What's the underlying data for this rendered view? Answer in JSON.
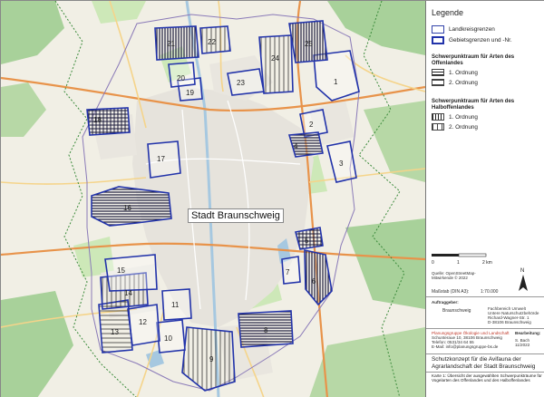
{
  "map": {
    "city_label": "Stadt Braunschweig",
    "area_numbers": [
      "1",
      "2",
      "3",
      "4",
      "5",
      "6",
      "7",
      "8",
      "9",
      "10",
      "11",
      "12",
      "13",
      "14",
      "15",
      "16",
      "17",
      "18",
      "19",
      "20",
      "21",
      "22",
      "23",
      "24",
      "25"
    ]
  },
  "legend": {
    "title": "Legende",
    "district_label": "Landkreisgrenzen",
    "area_label": "Gebietsgrenzen und -Nr.",
    "open_land_heading": "Schwerpunktraum für Arten des Offenlandes",
    "open_land_1": "1. Ordnung",
    "open_land_2": "2. Ordnung",
    "semi_open_heading": "Schwerpunktraum für Arten des Halboffenlandes",
    "semi_open_1": "1. Ordnung",
    "semi_open_2": "2. Ordnung",
    "scale_start": "0",
    "scale_mid": "1",
    "scale_end": "2 km",
    "north": "N",
    "source": "Quelle: OpenStreetMap-Mitwirkende © 2022",
    "scale_text": "Maßstab (DIN A3):",
    "scale_value": "1:70.000",
    "client_label": "Auftraggeber:",
    "client_logo": "Braunschweig",
    "client_dept": "Fachbereich Umwelt",
    "client_unit": "Untere Naturschutzbehörde",
    "client_addr1": "Richard-Wagner-Str. 1",
    "client_addr2": "D-38106 Braunschweig",
    "contractor_name": "Planungsgruppe Ökologie und Landschaft",
    "contractor_l1": "Schunteraue 10, 38106 Braunschweig",
    "contractor_l2": "Telefon: 0531/34 64 55",
    "contractor_l3": "E-Mail: info@planungsgruppe-bs.de",
    "editor_label": "Bearbeitung:",
    "editor_name": "S. Bach",
    "editor_date": "11/2022",
    "project_title": "Schutzkonzept für die Avifauna der Agrarlandschaft der Stadt Braunschweig",
    "map_caption": "Karte 1: Übersicht der ausgewählten Schwerpunkträume für Vogelarten des Offenlandes und des Halboffenlandes"
  },
  "colors": {
    "area_boundary": "#2233aa",
    "district_boundary": "#3344aa",
    "urban": "#e6e3dc",
    "farmland": "#f1efe5",
    "forest": "#a8d19a",
    "meadow": "#cde8b8",
    "water": "#a6c8e0",
    "motorway": "#e8934a",
    "road": "#f5d48a",
    "contractor_text": "#c0392b"
  }
}
